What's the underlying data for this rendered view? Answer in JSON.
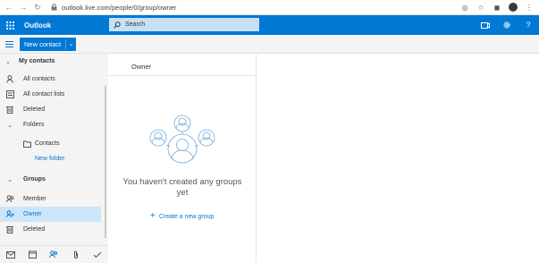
{
  "browser": {
    "url": "outlook.live.com/people/0/group/owner"
  },
  "app": {
    "name": "Outlook",
    "search_placeholder": "Search"
  },
  "commands": {
    "new_contact": "New contact"
  },
  "sidebar": {
    "sections": [
      {
        "label": "My contacts"
      },
      {
        "label": "All contacts"
      },
      {
        "label": "All contact lists"
      },
      {
        "label": "Deleted"
      },
      {
        "label": "Folders"
      },
      {
        "label": "Contacts"
      },
      {
        "label": "New folder"
      },
      {
        "label": "Groups"
      },
      {
        "label": "Member"
      },
      {
        "label": "Owner"
      },
      {
        "label": "Deleted"
      }
    ]
  },
  "list": {
    "header": "Owner",
    "empty_message": "You haven't created any groups yet",
    "create_link": "Create a new group"
  },
  "colors": {
    "brand": "#0078d4",
    "selected": "#cde6f7",
    "link": "#0078d4"
  }
}
